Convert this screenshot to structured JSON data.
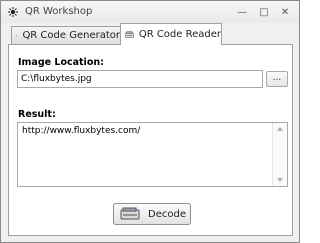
{
  "window": {
    "title": "QR Workshop",
    "controls": {
      "minimize": "—",
      "maximize": "□",
      "close": "✕"
    }
  },
  "tabs": [
    {
      "label": "QR Code Generator",
      "active": false,
      "icon": "qr-code-icon"
    },
    {
      "label": "QR Code Reader",
      "active": true,
      "icon": "scanner-icon"
    }
  ],
  "reader": {
    "image_location_label": "Image Location:",
    "image_location_value": "C:\\fluxbytes.jpg",
    "browse_label": "...",
    "result_label": "Result:",
    "result_value": "http://www.fluxbytes.com/",
    "decode_label": "Decode"
  },
  "colors": {
    "window_bg": "#f0f0f0",
    "panel_bg": "#ffffff",
    "border": "#a0a0a0"
  }
}
